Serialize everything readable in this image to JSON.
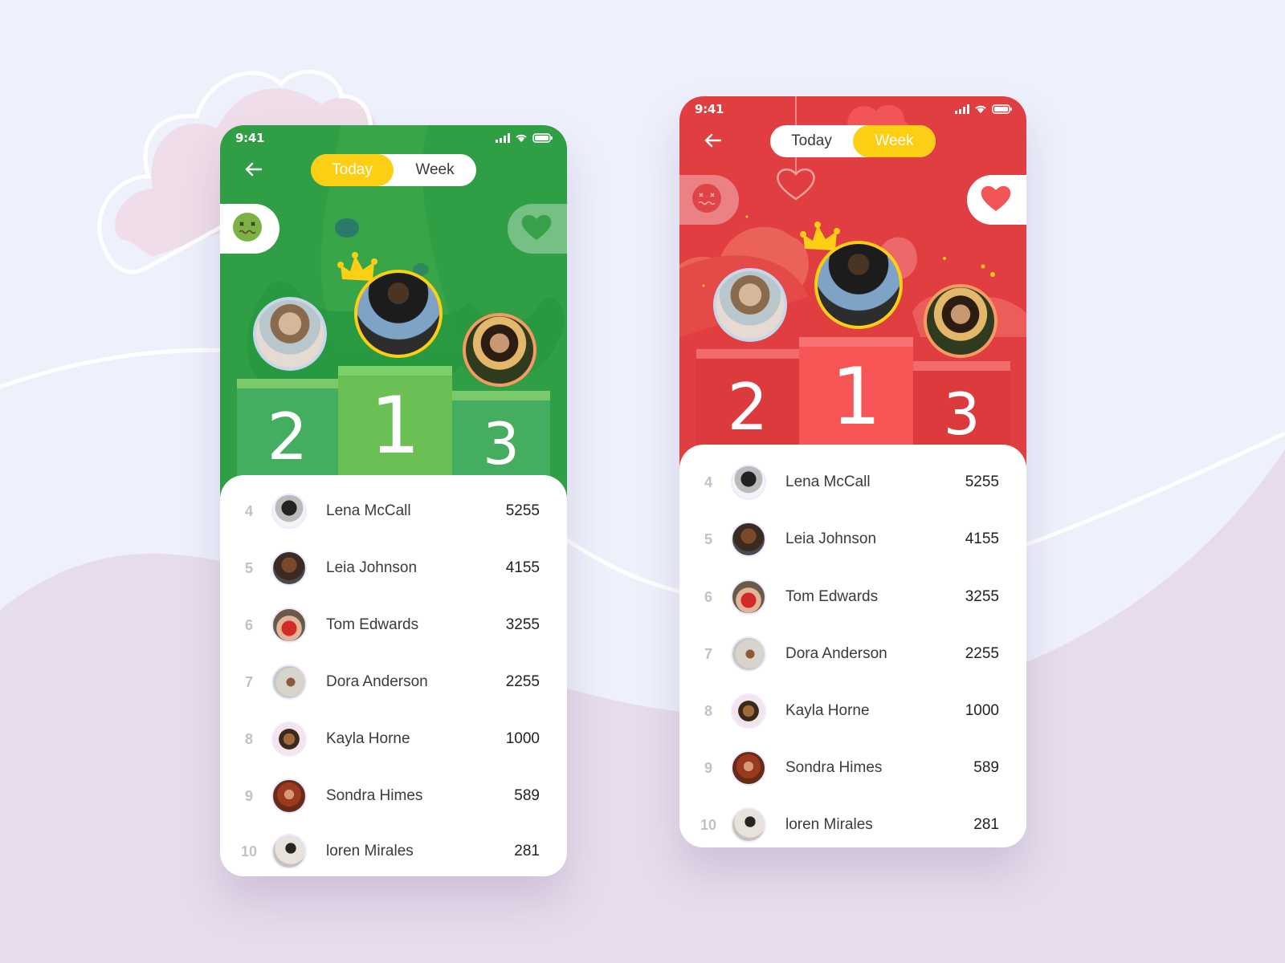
{
  "colors": {
    "page_bg": "#eef0fc",
    "page_bg_lower": "#e7dcec",
    "cloud_pink": "#efdde9",
    "green_theme": "#2f9e44",
    "green_podium_side": "#45ad5f",
    "green_podium_center": "#6abf55",
    "red_theme": "#e03e40",
    "red_podium_side": "#dc3b3d",
    "red_podium_center": "#f75455",
    "toggle_active": "#fcce14",
    "crown": "#fcce14",
    "rank1_ring": "#fcce14",
    "rank2_ring": "#c9d6ea",
    "rank3_ring": "#f49a62",
    "rank_text": "#c2c2c2",
    "name_text": "#3b3b3b",
    "score_text": "#222222"
  },
  "screens": [
    {
      "theme": "green",
      "status_bar": {
        "time": "9:41",
        "icons": [
          "signal-icon",
          "wifi-icon",
          "battery-icon"
        ]
      },
      "back_icon": "arrow-left-icon",
      "toggle": {
        "options": [
          "Today",
          "Week"
        ],
        "selected": "Today"
      },
      "side_buttons": {
        "left_icon": "dizzy-face-icon",
        "right_icon": "heart-icon"
      },
      "podium": [
        {
          "rank": "2",
          "label": "2"
        },
        {
          "rank": "1",
          "label": "1"
        },
        {
          "rank": "3",
          "label": "3"
        }
      ],
      "leaderboard": [
        {
          "rank": "4",
          "name": "Lena McCall",
          "score": "5255"
        },
        {
          "rank": "5",
          "name": "Leia Johnson",
          "score": "4155"
        },
        {
          "rank": "6",
          "name": "Tom Edwards",
          "score": "3255"
        },
        {
          "rank": "7",
          "name": "Dora Anderson",
          "score": "2255"
        },
        {
          "rank": "8",
          "name": "Kayla Horne",
          "score": "1000"
        },
        {
          "rank": "9",
          "name": "Sondra Himes",
          "score": "589"
        },
        {
          "rank": "10",
          "name": "loren Mirales",
          "score": "281"
        }
      ]
    },
    {
      "theme": "red",
      "status_bar": {
        "time": "9:41",
        "icons": [
          "signal-icon",
          "wifi-icon",
          "battery-icon"
        ]
      },
      "back_icon": "arrow-left-icon",
      "toggle": {
        "options": [
          "Today",
          "Week"
        ],
        "selected": "Week"
      },
      "side_buttons": {
        "left_icon": "dizzy-face-icon",
        "right_icon": "heart-icon"
      },
      "podium": [
        {
          "rank": "2",
          "label": "2"
        },
        {
          "rank": "1",
          "label": "1"
        },
        {
          "rank": "3",
          "label": "3"
        }
      ],
      "leaderboard": [
        {
          "rank": "4",
          "name": "Lena McCall",
          "score": "5255"
        },
        {
          "rank": "5",
          "name": "Leia Johnson",
          "score": "4155"
        },
        {
          "rank": "6",
          "name": "Tom Edwards",
          "score": "3255"
        },
        {
          "rank": "7",
          "name": "Dora Anderson",
          "score": "2255"
        },
        {
          "rank": "8",
          "name": "Kayla Horne",
          "score": "1000"
        },
        {
          "rank": "9",
          "name": "Sondra Himes",
          "score": "589"
        },
        {
          "rank": "10",
          "name": "loren Mirales",
          "score": "281"
        }
      ]
    }
  ]
}
